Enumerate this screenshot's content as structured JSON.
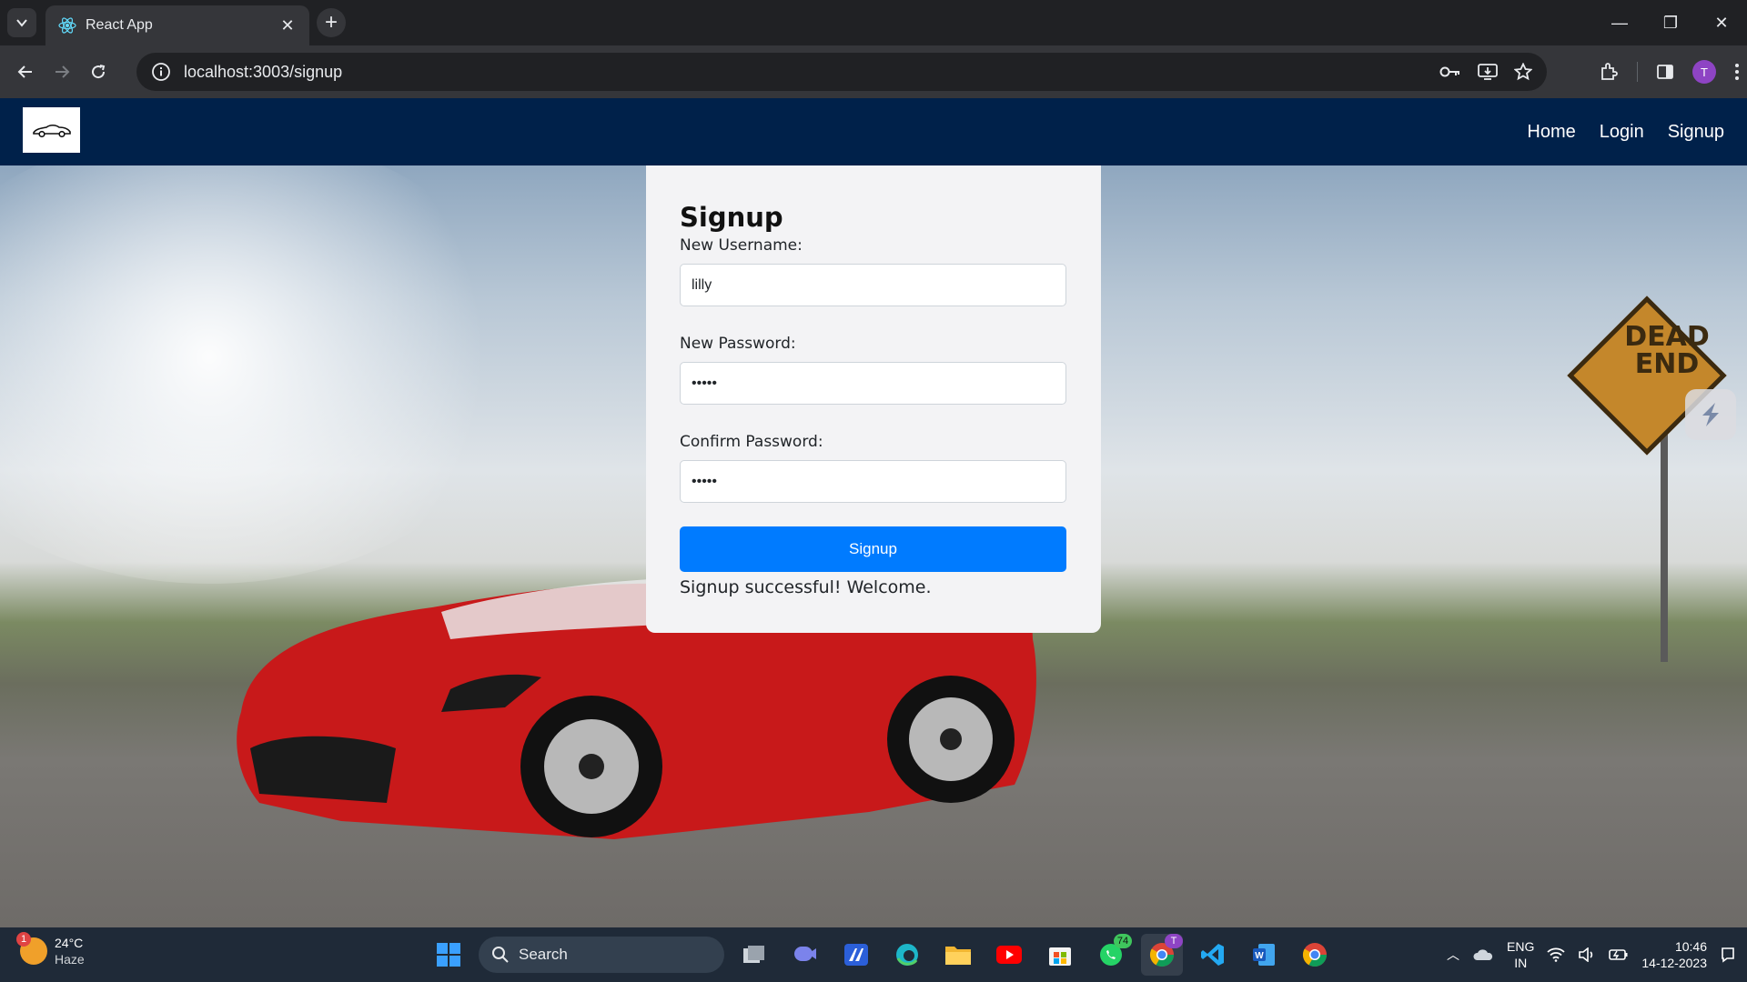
{
  "browser": {
    "tab_title": "React App",
    "url": "localhost:3003/signup",
    "profile_initial": "T"
  },
  "app": {
    "nav_links": [
      "Home",
      "Login",
      "Signup"
    ],
    "logo_icon": "car-logo"
  },
  "form": {
    "title": "Signup",
    "username_label": "New Username:",
    "username_value": "lilly",
    "password_label": "New Password:",
    "password_value": "•••••",
    "confirm_label": "Confirm Password:",
    "confirm_value": "•••••",
    "button_label": "Signup",
    "message": "Signup successful! Welcome."
  },
  "sign": {
    "line1": "DEAD",
    "line2": "END"
  },
  "taskbar": {
    "weather_badge": "1",
    "temperature": "24°C",
    "condition": "Haze",
    "search_label": "Search",
    "whatsapp_badge": "74",
    "chrome_badge": "T",
    "lang_line1": "ENG",
    "lang_line2": "IN",
    "time": "10:46",
    "date": "14-12-2023"
  },
  "colors": {
    "navbar": "#00214a",
    "button": "#007bff",
    "card": "#f3f3f5"
  }
}
